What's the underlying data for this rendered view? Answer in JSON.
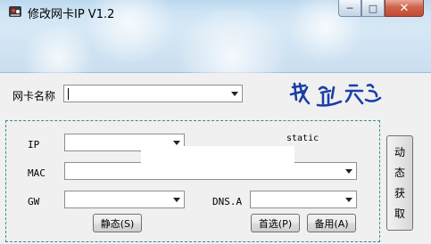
{
  "window": {
    "title": "修改网卡IP V1.2",
    "controls": {
      "minimize": "─",
      "maximize": "□",
      "close": "✕"
    }
  },
  "nic": {
    "label": "网卡名称",
    "value": ""
  },
  "logo": {
    "text": "我逸言"
  },
  "fields": {
    "ip": {
      "label": "IP",
      "value": ""
    },
    "mac": {
      "label": "MAC",
      "value": ""
    },
    "gw": {
      "label": "GW",
      "value": ""
    },
    "dns": {
      "label": "DNS.A",
      "value": ""
    }
  },
  "status": {
    "mode": "static"
  },
  "buttons": {
    "static": "静态(S)",
    "preferred": "首选(P)",
    "backup": "备用(A)",
    "dynamic": [
      "动",
      "态",
      "获",
      "取"
    ]
  },
  "icons": {
    "app": "app-icon",
    "dropdown": "chevron-down-icon"
  },
  "colors": {
    "titlebar": "#c9def0",
    "client": "#f0f0f0",
    "dashed_border": "#2f8f8f",
    "close_button": "#c24a33",
    "logo_ink": "#1b3fa8"
  }
}
